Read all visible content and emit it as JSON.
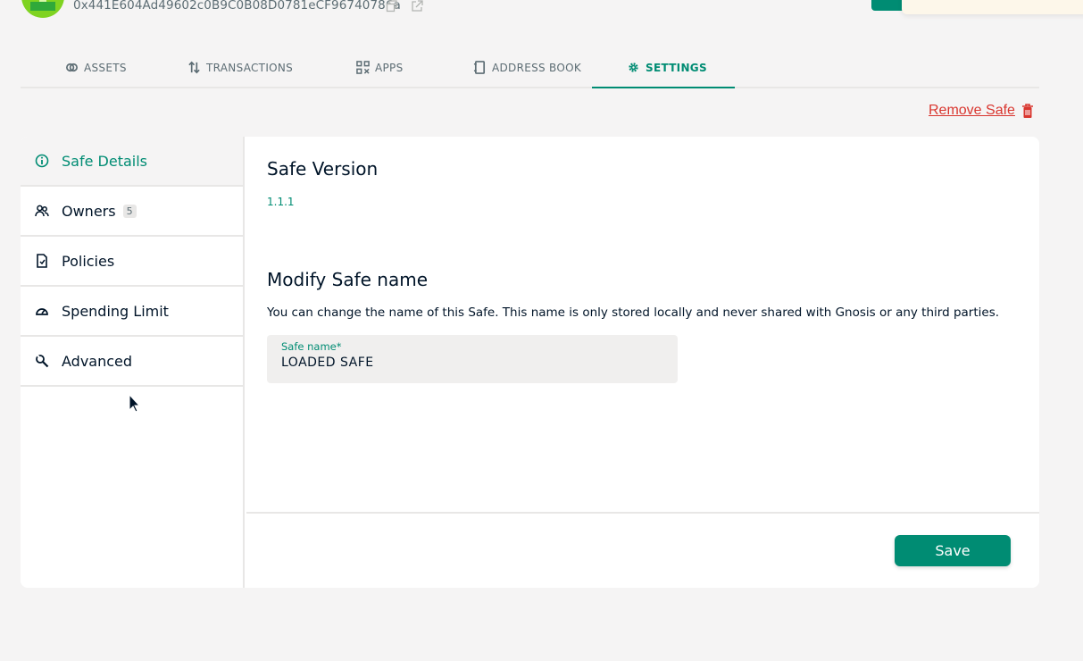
{
  "header": {
    "address": "0x441E604Ad49602c0B9C0B08D0781eCF96740786a",
    "icons": [
      "copy-icon",
      "external-link-icon"
    ]
  },
  "tabs": [
    {
      "label": "ASSETS",
      "icon": "assets-icon"
    },
    {
      "label": "TRANSACTIONS",
      "icon": "transactions-icon"
    },
    {
      "label": "APPS",
      "icon": "apps-icon"
    },
    {
      "label": "ADDRESS BOOK",
      "icon": "address-book-icon"
    },
    {
      "label": "SETTINGS",
      "icon": "gear-icon",
      "active": true
    }
  ],
  "remove_safe": {
    "label": "Remove Safe",
    "icon": "trash-icon"
  },
  "sidebar": {
    "items": [
      {
        "label": "Safe Details",
        "icon": "info-icon",
        "active": true
      },
      {
        "label": "Owners",
        "icon": "owners-icon",
        "badge": "5"
      },
      {
        "label": "Policies",
        "icon": "policies-icon"
      },
      {
        "label": "Spending Limit",
        "icon": "gauge-icon"
      },
      {
        "label": "Advanced",
        "icon": "wrench-icon"
      }
    ]
  },
  "main": {
    "version_title": "Safe Version",
    "version_value": "1.1.1",
    "modify_title": "Modify Safe name",
    "description": "You can change the name of this Safe. This name is only stored locally and never shared with Gnosis or any third parties.",
    "field": {
      "label": "Safe name*",
      "value": "LOADED SAFE"
    },
    "save_label": "Save"
  },
  "colors": {
    "accent": "#008c73",
    "danger": "#d9362f",
    "background": "#f5f4f4"
  }
}
